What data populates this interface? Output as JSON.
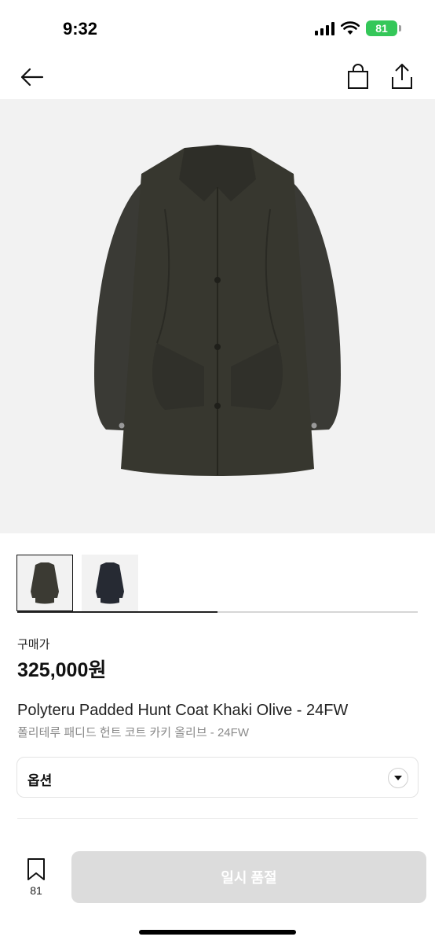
{
  "status_bar": {
    "time": "9:32",
    "battery": "81"
  },
  "icons": {
    "back": "arrow-left-icon",
    "bag": "shopping-bag-icon",
    "share": "share-icon",
    "bookmark": "bookmark-icon",
    "chevron": "chevron-down-icon"
  },
  "gallery": {
    "current": 1,
    "total": 2,
    "progress": 0.5
  },
  "thumbnails": [
    {
      "label": "khaki-olive",
      "color": "#3b3a33",
      "selected": true
    },
    {
      "label": "navy",
      "color": "#262a33",
      "selected": false
    }
  ],
  "price": {
    "label": "구매가",
    "value": "325,000원"
  },
  "product": {
    "name": "Polyteru Padded Hunt Coat Khaki Olive - 24FW",
    "name_ko": "폴리테루 패디드 헌트 코트 카키 올리브 - 24FW"
  },
  "option": {
    "label": "옵션"
  },
  "bottom_bar": {
    "wish_count": "81",
    "buy_label": "일시 품절"
  },
  "colors": {
    "accent": "#34c759",
    "disabled_button": "#dcdcdc"
  }
}
